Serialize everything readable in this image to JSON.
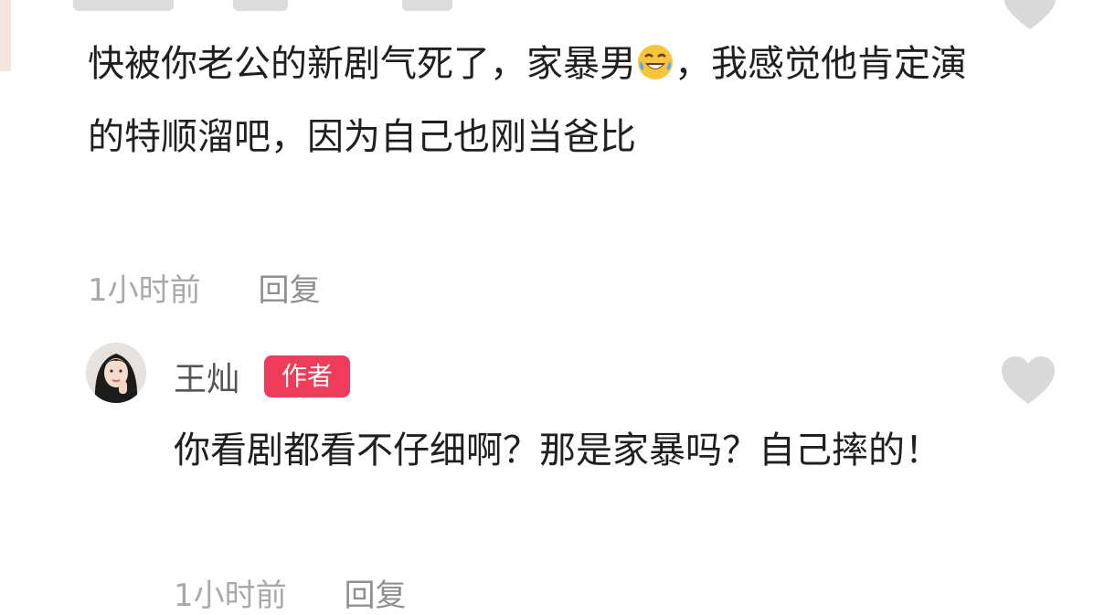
{
  "comment": {
    "text_before_emoji": "快被你老公的新剧气死了，家暴男",
    "emoji_icon": "rolling-on-floor-laughing-emoji",
    "text_after_emoji": "，我感觉他肯定演的特顺溜吧，因为自己也刚当爸比",
    "time": "1小时前",
    "reply_label": "回复"
  },
  "reply": {
    "author_name": "王灿",
    "author_badge": "作者",
    "badge_color": "#ee3c5a",
    "text": "你看剧都看不仔细啊？那是家暴吗？自己摔的！",
    "time": "1小时前",
    "reply_label": "回复"
  },
  "icons": {
    "like": "heart-icon",
    "avatar": "avatar"
  }
}
